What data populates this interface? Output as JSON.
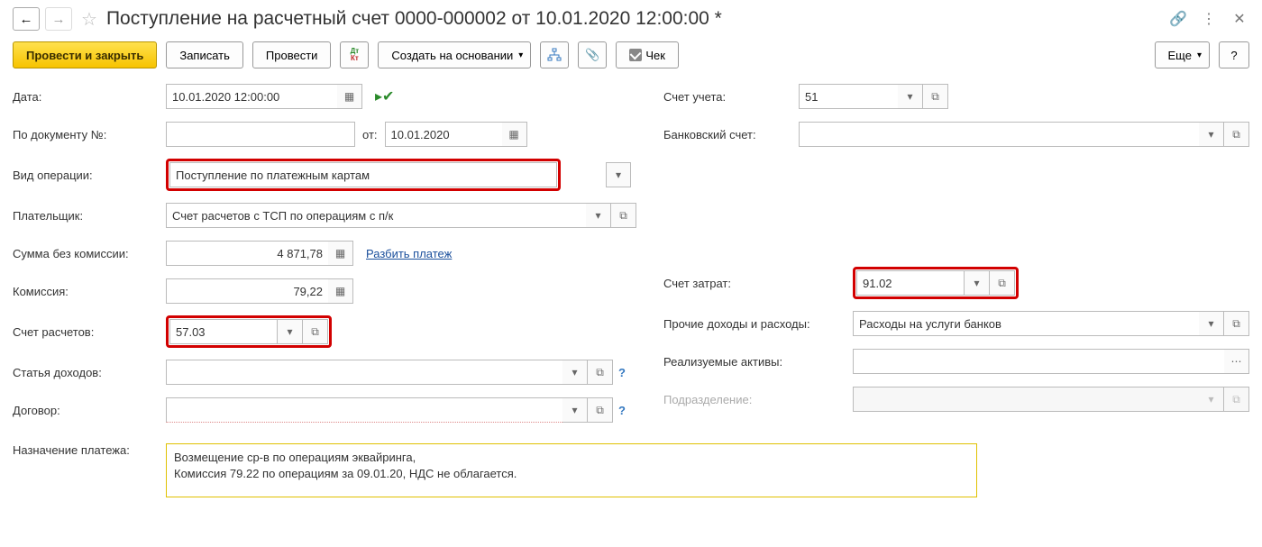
{
  "header": {
    "title": "Поступление на расчетный счет 0000-000002 от 10.01.2020 12:00:00 *"
  },
  "toolbar": {
    "primary": "Провести и закрыть",
    "save": "Записать",
    "post": "Провести",
    "create_based": "Создать на основании",
    "check": "Чек",
    "more": "Еще",
    "help": "?"
  },
  "left": {
    "date_label": "Дата:",
    "date_value": "10.01.2020 12:00:00",
    "docnum_label": "По документу №:",
    "docnum_value": "",
    "from_label": "от:",
    "from_value": "10.01.2020",
    "optype_label": "Вид операции:",
    "optype_value": "Поступление по платежным картам",
    "payer_label": "Плательщик:",
    "payer_value": "Счет расчетов с ТСП по операциям с п/к",
    "sum_label": "Сумма без комиссии:",
    "sum_value": "4 871,78",
    "split_link": "Разбить платеж",
    "commission_label": "Комиссия:",
    "commission_value": "79,22",
    "acct_label": "Счет расчетов:",
    "acct_value": "57.03",
    "income_label": "Статья доходов:",
    "income_value": "",
    "contract_label": "Договор:",
    "contract_value": ""
  },
  "right": {
    "ledger_label": "Счет учета:",
    "ledger_value": "51",
    "bank_label": "Банковский счет:",
    "bank_value": "",
    "cost_label": "Счет затрат:",
    "cost_value": "91.02",
    "other_label": "Прочие доходы и расходы:",
    "other_value": "Расходы на услуги банков",
    "assets_label": "Реализуемые активы:",
    "assets_value": "",
    "dept_label": "Подразделение:",
    "dept_value": ""
  },
  "purpose": {
    "label": "Назначение платежа:",
    "line1": "Возмещение ср-в по операциям эквайринга,",
    "line2": "Комиссия 79.22 по операциям за 09.01.20, НДС не облагается."
  }
}
